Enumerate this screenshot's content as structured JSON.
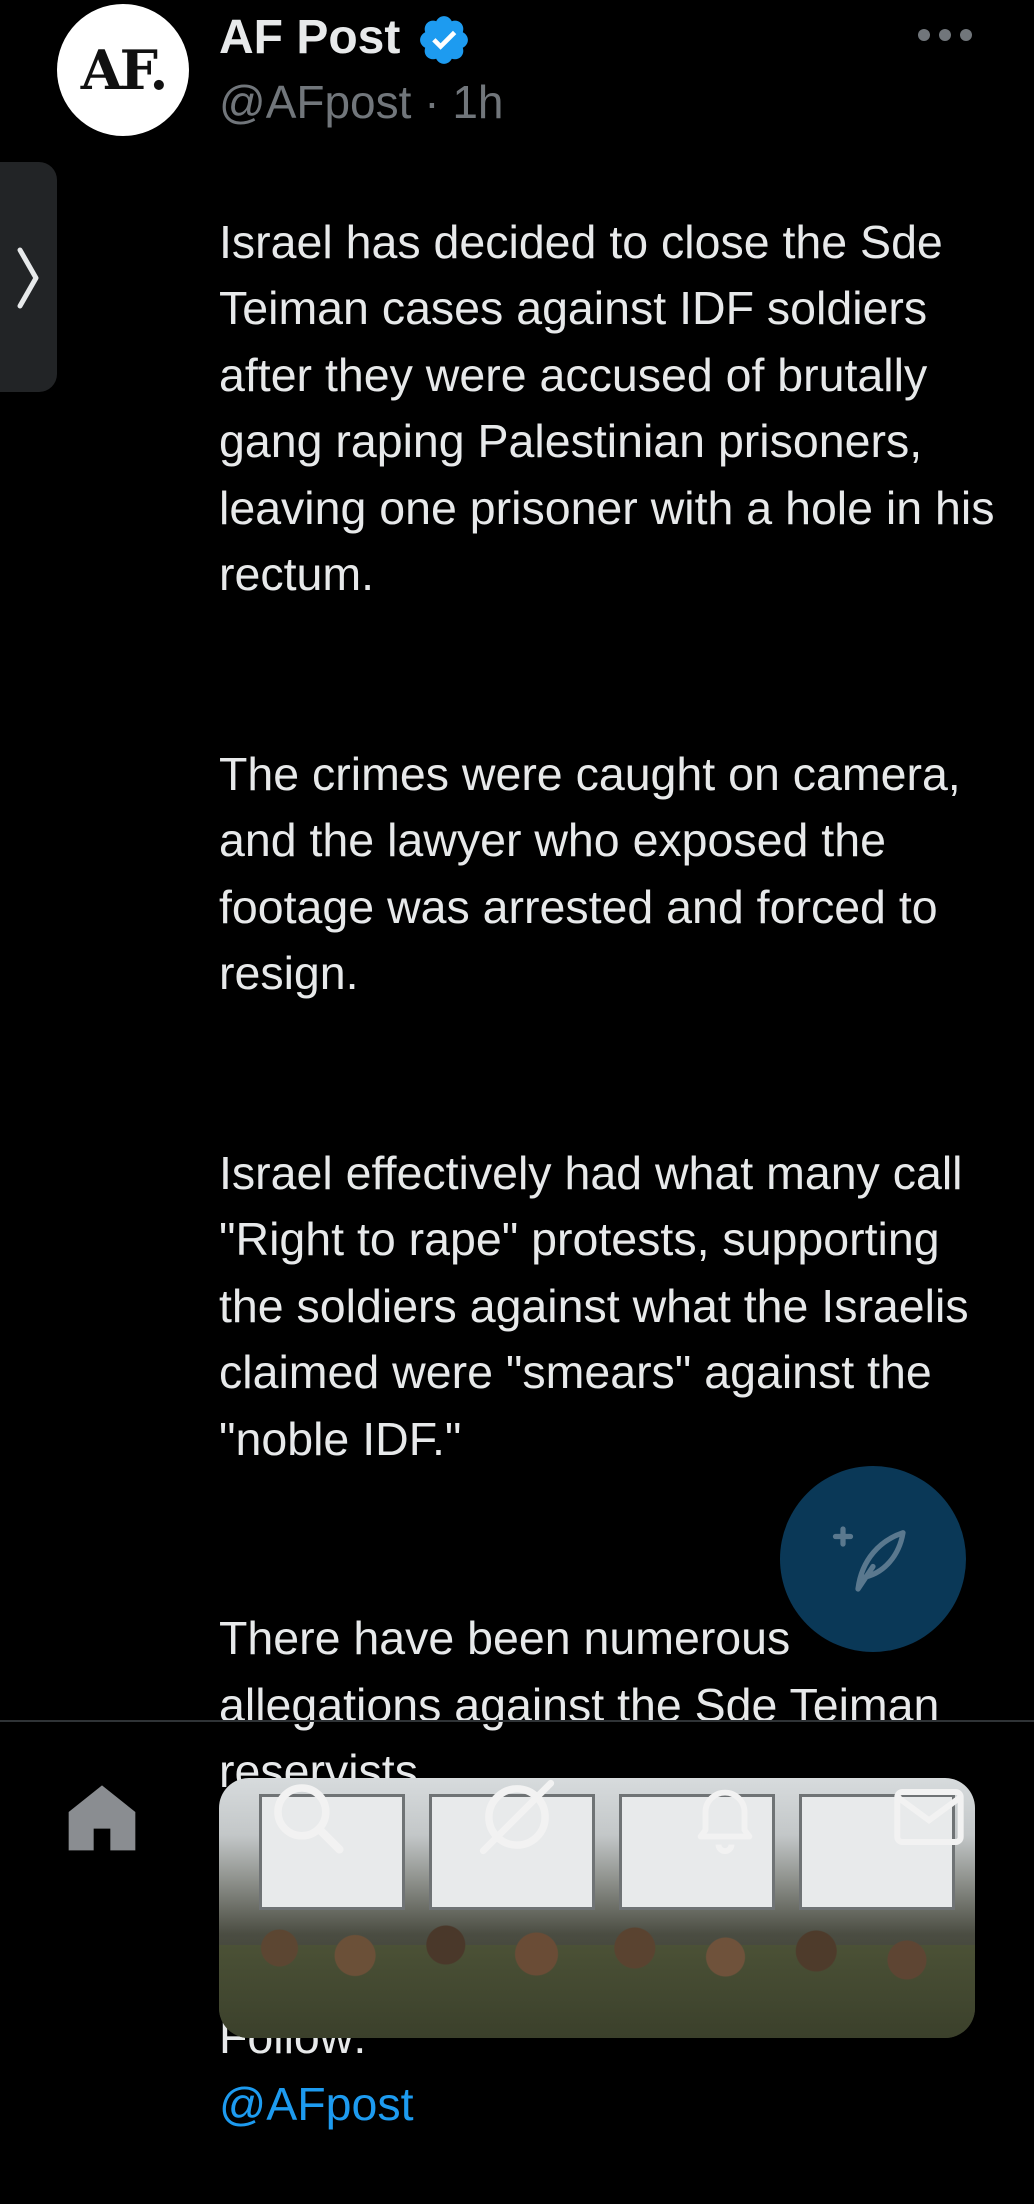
{
  "post": {
    "avatar_text": "AF.",
    "author_name": "AF Post",
    "handle": "@AFpost",
    "separator": "·",
    "time": "1h",
    "paragraphs": [
      "Israel has decided to close the Sde Teiman cases against IDF soldiers after they were accused of brutally gang raping Palestinian prisoners, leaving one prisoner with a hole in his rectum.",
      "The crimes were caught on camera, and the lawyer who exposed the footage was arrested and forced to resign.",
      "Israel effectively had what many call \"Right to rape\" protests, supporting the soldiers against what the Israelis claimed were \"smears\" against the \"noble IDF.\"",
      "There have been numerous allegations against the Sde Teiman reservists."
    ],
    "follow_label": "Follow:",
    "follow_mention": "@AFpost"
  },
  "icons": {
    "verified": "verified-badge-icon",
    "more": "more-options-icon",
    "side_handle": "chevron-right-icon",
    "compose": "compose-feather-icon",
    "nav": [
      "home-icon",
      "search-icon",
      "grok-icon",
      "notifications-bell-icon",
      "messages-envelope-icon"
    ]
  },
  "colors": {
    "background": "#000000",
    "text": "#e7e9ea",
    "secondary": "#71767b",
    "accent": "#1d9bf0"
  }
}
